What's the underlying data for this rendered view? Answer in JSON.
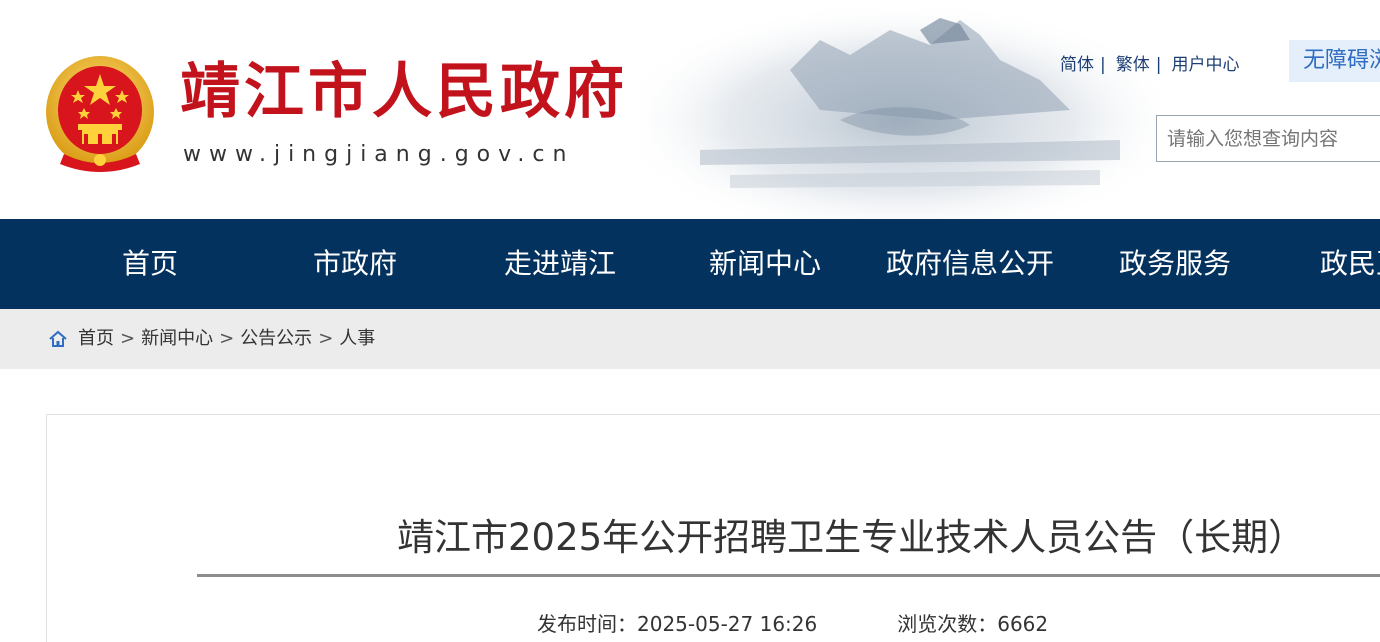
{
  "header": {
    "site_title": "靖江市人民政府",
    "site_url": "www.jingjiang.gov.cn",
    "links": [
      "简体",
      "繁体",
      "用户中心"
    ],
    "accessibility_label": "无障碍浏览",
    "search_placeholder": "请输入您想查询内容"
  },
  "nav": {
    "items": [
      "首页",
      "市政府",
      "走进靖江",
      "新闻中心",
      "政府信息公开",
      "政务服务",
      "政民互动"
    ]
  },
  "breadcrumb": {
    "items": [
      "首页",
      "新闻中心",
      "公告公示",
      "人事"
    ],
    "separator": ">"
  },
  "article": {
    "title": "靖江市2025年公开招聘卫生专业技术人员公告（长期）",
    "publish_label": "发布时间：",
    "publish_time": "2025-05-27 16:26",
    "views_label": "浏览次数：",
    "views": "6662"
  },
  "colors": {
    "nav_bg": "#03325e",
    "title_red": "#c2121c",
    "link_blue": "#1e3f75",
    "breadcrumb_bg": "#ececec"
  }
}
